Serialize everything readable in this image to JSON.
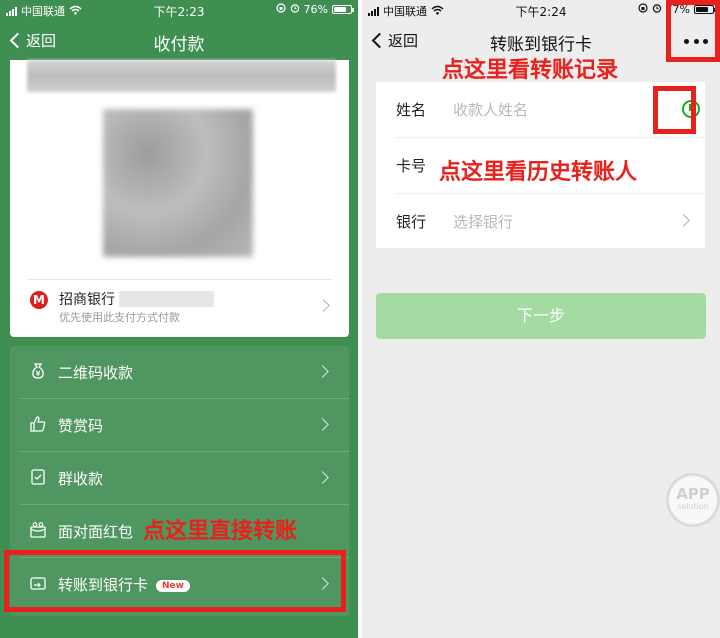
{
  "left_screen": {
    "status": {
      "carrier": "中国联通",
      "time": "下午2:23",
      "battery": "76%",
      "battery_level": 0.76
    },
    "nav": {
      "back_label": "返回",
      "title": "收付款"
    },
    "payment_method": {
      "bank": "招商银行",
      "hint": "优先使用此支付方式付款",
      "logo_char": "M"
    },
    "menu": [
      {
        "label": "二维码收款",
        "icon": "money-bag-icon"
      },
      {
        "label": "赞赏码",
        "icon": "thumbs-up-icon"
      },
      {
        "label": "群收款",
        "icon": "group-bill-icon"
      },
      {
        "label": "面对面红包",
        "icon": "red-packet-icon"
      },
      {
        "label": "转账到银行卡",
        "icon": "bank-card-transfer-icon",
        "badge": "New"
      }
    ],
    "annotation": "点这里直接转账"
  },
  "right_screen": {
    "status": {
      "carrier": "中国联通",
      "time": "下午2:24",
      "battery": "77%",
      "battery_level": 0.77
    },
    "nav": {
      "back_label": "返回",
      "title": "转账到银行卡",
      "more_icon": "more-dots-icon"
    },
    "form": [
      {
        "label": "姓名",
        "placeholder": "收款人姓名",
        "icon": "clock-history-icon"
      },
      {
        "label": "卡号",
        "placeholder": ""
      },
      {
        "label": "银行",
        "placeholder": "选择银行",
        "icon": "chevron-right-icon"
      }
    ],
    "next_button": "下一步",
    "annotations": {
      "records": "点这里看转账记录",
      "history": "点这里看历史转账人"
    },
    "watermark": {
      "line1": "APP",
      "line2": "solution"
    }
  },
  "colors": {
    "wechat_green_dark": "#3f8f52",
    "wechat_green": "#1aad19",
    "annotation_red": "#e8211c",
    "next_button_disabled": "#a3dba3"
  }
}
